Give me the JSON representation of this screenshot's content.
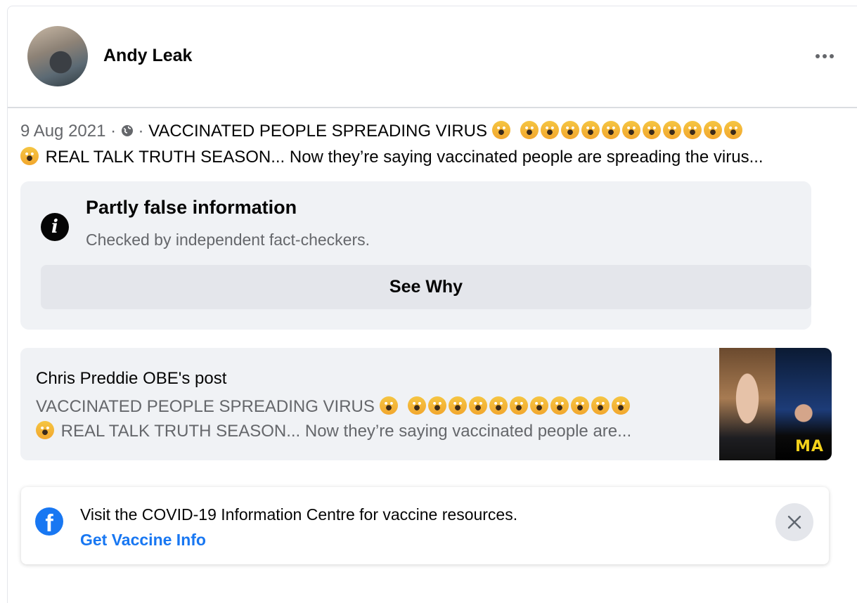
{
  "post": {
    "author": "Andy Leak",
    "date": "9 Aug 2021",
    "separator": " · ",
    "privacy_icon": "globe-icon",
    "text_line1": "VACCINATED PEOPLE SPREADING VIRUS",
    "text_line2": "REAL TALK TRUTH SEASON... Now they’re saying vaccinated people are spreading the virus...",
    "emoji": "face-screaming-in-fear"
  },
  "fact_check": {
    "title": "Partly false information",
    "subtitle": "Checked by independent fact-checkers.",
    "button_label": "See Why",
    "icon": "info-icon"
  },
  "shared_post": {
    "name": "Chris Preddie OBE's post",
    "text_line1": "VACCINATED PEOPLE SPREADING VIRUS",
    "text_line2": "REAL TALK TRUTH SEASON... Now they’re saying vaccinated people are...",
    "thumbnail_text": "MA"
  },
  "covid_banner": {
    "message": "Visit the COVID-19 Information Centre for vaccine resources.",
    "link": "Get Vaccine Info",
    "logo": "facebook-logo",
    "close_icon": "close-icon"
  },
  "colors": {
    "link_blue": "#1877f2",
    "secondary_text": "#65676b",
    "panel_bg": "#f0f2f5"
  }
}
